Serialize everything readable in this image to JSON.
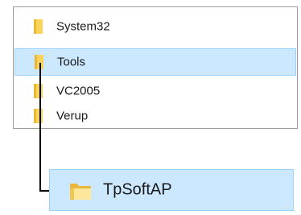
{
  "tree": {
    "items": [
      {
        "label": "System32",
        "icon": "folder-icon",
        "selected": false
      },
      {
        "label": "Tools",
        "icon": "folder-icon",
        "selected": true
      },
      {
        "label": "VC2005",
        "icon": "folder-icon",
        "selected": false
      },
      {
        "label": "Verup",
        "icon": "folder-icon",
        "selected": false
      }
    ]
  },
  "destination": {
    "label": "TpSoftAP",
    "icon": "folder-icon",
    "selected": true
  },
  "colors": {
    "selection_bg": "#cce8ff",
    "selection_border": "#99d1ff",
    "folder_yellow": "#f6c94a",
    "folder_light": "#fde79a",
    "arrow": "#000000",
    "panel_border": "#9a9a9a"
  }
}
